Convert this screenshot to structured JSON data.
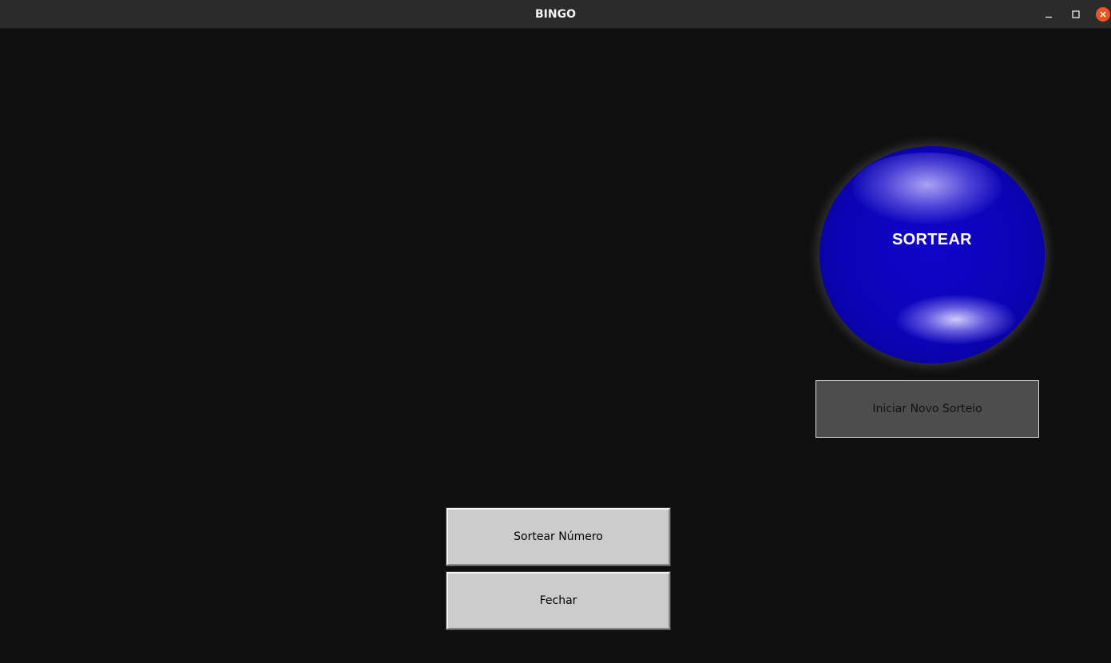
{
  "window": {
    "title": "BINGO",
    "controls": [
      "minimize-icon",
      "maximize-icon",
      "close-icon"
    ]
  },
  "ball": {
    "label": "SORTEAR",
    "color": "#0c03b8"
  },
  "buttons": {
    "new_draw": "Iniciar Novo Sorteio",
    "draw_number": "Sortear Número",
    "close": "Fechar"
  },
  "colors": {
    "background": "#0f0f0f",
    "titlebar": "#2b2b2b",
    "close_accent": "#e95420",
    "button_gray": "#cccccc",
    "button_dark": "#4d4d4d"
  }
}
